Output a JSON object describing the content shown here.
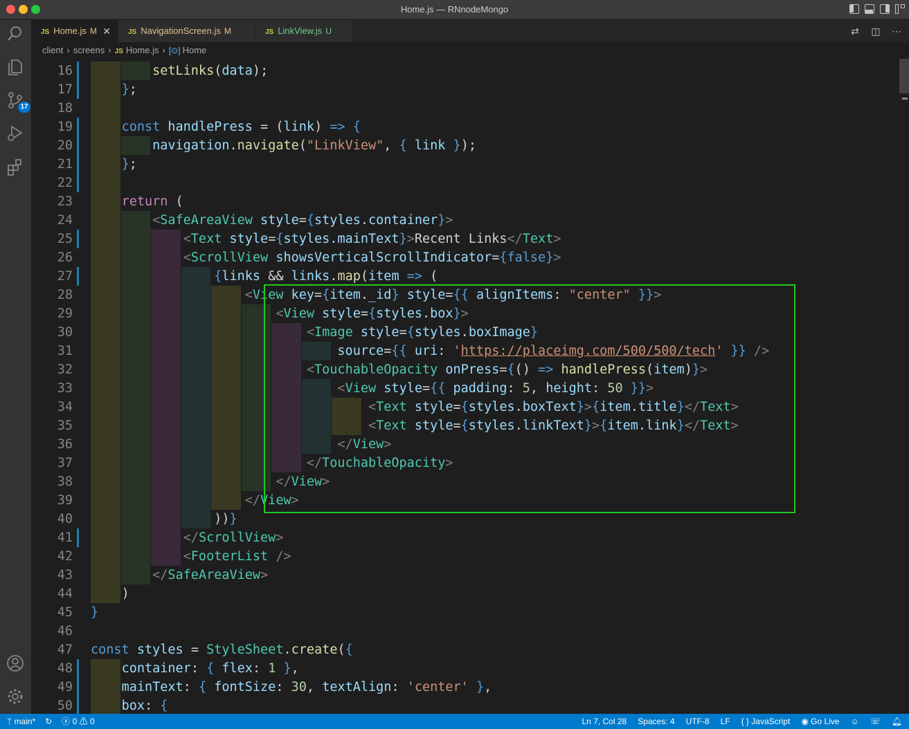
{
  "window": {
    "title": "Home.js — RNnodeMongo"
  },
  "activity_bar": {
    "items": [
      {
        "name": "search-icon"
      },
      {
        "name": "explorer-icon"
      },
      {
        "name": "source-control-icon",
        "badge": "17"
      },
      {
        "name": "run-debug-icon"
      },
      {
        "name": "extensions-icon"
      }
    ],
    "bottom": [
      {
        "name": "account-icon"
      },
      {
        "name": "settings-gear-icon"
      }
    ]
  },
  "tabs": [
    {
      "icon": "JS",
      "label": "Home.js",
      "status": "M",
      "active": true
    },
    {
      "icon": "JS",
      "label": "NavigationScreen.js",
      "status": "M",
      "active": false
    },
    {
      "icon": "JS",
      "label": "LinkView.js",
      "status": "U",
      "active": false
    }
  ],
  "breadcrumb": {
    "parts": [
      "client",
      "screens"
    ],
    "file_icon": "JS",
    "file": "Home.js",
    "symbol": "Home"
  },
  "code": {
    "line_numbers": [
      "16",
      "17",
      "18",
      "19",
      "20",
      "21",
      "22",
      "23",
      "24",
      "25",
      "26",
      "27",
      "28",
      "29",
      "30",
      "31",
      "32",
      "33",
      "34",
      "35",
      "36",
      "37",
      "38",
      "39",
      "40",
      "41",
      "42",
      "43",
      "44",
      "45",
      "46",
      "47",
      "48",
      "49",
      "50"
    ],
    "lines": [
      "    setLinks(data);",
      "  };",
      "",
      "  const handlePress = (link) => {",
      "    navigation.navigate(\"LinkView\", { link });",
      "  };",
      "",
      "  return (",
      "    <SafeAreaView style={styles.container}>",
      "      <Text style={styles.mainText}>Recent Links</Text>",
      "      <ScrollView showsVerticalScrollIndicator={false}>",
      "        {links && links.map(item => (",
      "          <View key={item._id} style={{ alignItems: \"center\" }}>",
      "            <View style={styles.box}>",
      "              <Image style={styles.boxImage}",
      "                source={{ uri: 'https://placeimg.com/500/500/tech' }} />",
      "              <TouchableOpacity onPress={() => handlePress(item)}>",
      "                <View style={{ padding: 5, height: 50 }}>",
      "                  <Text style={styles.boxText}>{item.title}</Text>",
      "                  <Text style={styles.linkText}>{item.link}</Text>",
      "                </View>",
      "              </TouchableOpacity>",
      "            </View>",
      "          </View>",
      "        ))}",
      "      </ScrollView>",
      "      <FooterList />",
      "    </SafeAreaView>",
      "  )",
      "}",
      "",
      "const styles = StyleSheet.create({",
      "  container: { flex: 1 },",
      "  mainText: { fontSize: 30, textAlign: 'center' },",
      "  box: {"
    ]
  },
  "status_bar": {
    "branch": "main*",
    "sync_icon": "sync-icon",
    "errors": "0",
    "warnings": "0",
    "position": "Ln 7, Col 28",
    "spaces": "Spaces: 4",
    "encoding": "UTF-8",
    "eol": "LF",
    "language": "JavaScript",
    "live": "Go Live"
  },
  "colors": {
    "statusbar": "#007acc",
    "highlight_box": "#22c922"
  }
}
